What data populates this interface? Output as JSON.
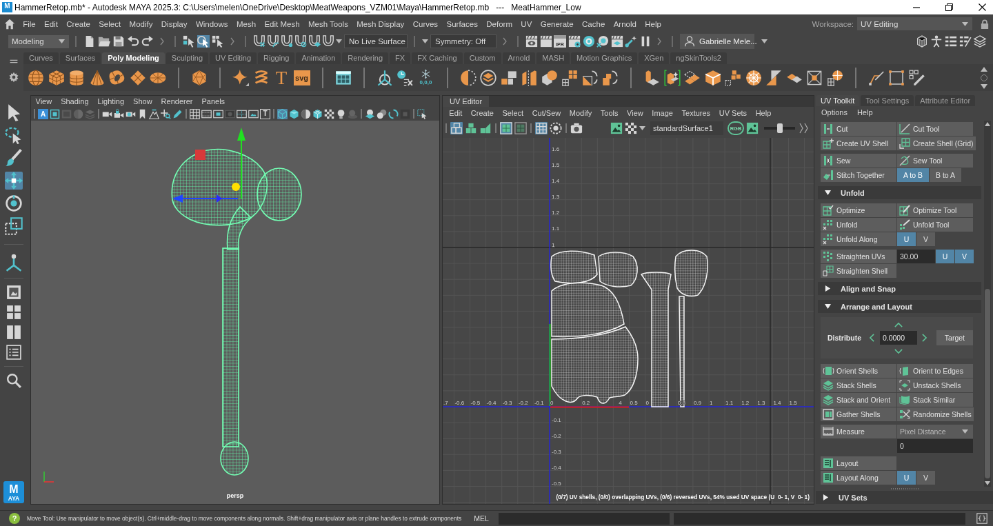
{
  "window": {
    "logo_letter": "M",
    "title": "HammerRetop.mb* - Autodesk MAYA 2025.3: C:\\Users\\melen\\OneDrive\\Desktop\\MeatWeapons_VZM01\\Maya\\HammerRetop.mb   ---   MeatHammer_Low"
  },
  "menu_bar": {
    "items": [
      "File",
      "Edit",
      "Create",
      "Select",
      "Modify",
      "Display",
      "Windows",
      "Mesh",
      "Edit Mesh",
      "Mesh Tools",
      "Mesh Display",
      "Curves",
      "Surfaces",
      "Deform",
      "UV",
      "Generate",
      "Cache",
      "Arnold",
      "Help"
    ],
    "workspace_label": "Workspace:",
    "workspace": "UV Editing"
  },
  "status_line": {
    "menu_set": "Modeling",
    "select_modes": [
      {
        "selected": false
      },
      {
        "selected": true
      },
      {
        "selected": false
      }
    ],
    "live_surface": "No Live Surface",
    "symmetry": "Symmetry: Off",
    "ipr_label": "IPR",
    "user": "Gabrielle Mele..."
  },
  "shelf": {
    "tabs": [
      {
        "label": "Curves",
        "selected": false
      },
      {
        "label": "Surfaces",
        "selected": false
      },
      {
        "label": "Poly Modeling",
        "selected": true
      },
      {
        "label": "Sculpting",
        "selected": false
      },
      {
        "label": "UV Editing",
        "selected": false
      },
      {
        "label": "Rigging",
        "selected": false
      },
      {
        "label": "Animation",
        "selected": false
      },
      {
        "label": "Rendering",
        "selected": false
      },
      {
        "label": "FX",
        "selected": false
      },
      {
        "label": "FX Caching",
        "selected": false
      },
      {
        "label": "Custom",
        "selected": false
      },
      {
        "label": "Arnold",
        "selected": false
      },
      {
        "label": "MASH",
        "selected": false
      },
      {
        "label": "Motion Graphics",
        "selected": false
      },
      {
        "label": "XGen",
        "selected": false
      },
      {
        "label": "ngSkinTools2",
        "selected": false
      }
    ],
    "text_tool_letter": "T",
    "svg_label": "svg",
    "freeze_caption": "0,0,0"
  },
  "toolbox": {
    "tools": [
      {
        "selected": false
      },
      {
        "selected": false
      },
      {
        "selected": false
      },
      {
        "selected": true
      },
      {
        "selected": false
      },
      {
        "selected": false
      }
    ],
    "logo": {
      "letter": "M",
      "caption": "AYA"
    }
  },
  "viewport": {
    "menu": [
      "View",
      "Shading",
      "Lighting",
      "Show",
      "Renderer",
      "Panels"
    ],
    "toolbar_letters": [
      "A",
      "T"
    ],
    "shading_modes": [
      {
        "selected": true
      },
      {
        "selected": false
      }
    ],
    "camera": "persp"
  },
  "uv_editor": {
    "tab": "UV Editor",
    "menu": [
      "Edit",
      "Create",
      "Select",
      "Cut/Sew",
      "Modify",
      "Tools",
      "View",
      "Image",
      "Textures",
      "UV Sets",
      "Help"
    ],
    "toolbar_groups": [
      [
        {
          "selected": true
        },
        {
          "selected": false
        },
        {
          "selected": false
        }
      ],
      [
        {
          "selected": true
        },
        {
          "selected": false
        }
      ],
      [
        {
          "selected": true
        },
        {
          "selected": false
        }
      ]
    ],
    "texture": "standardSurface1",
    "rgb_label": "RGB",
    "slider": {
      "level": 0.5
    },
    "v_ticks": [
      "1.6",
      "1.5",
      "1.4",
      "1.3",
      "1.2",
      "1.1",
      "1",
      "-0.1",
      "-0.2",
      "-0.3",
      "-0.4",
      "-0.5"
    ],
    "u_ticks": [
      ".7",
      "-0.6",
      "-0.5",
      "-0.4",
      "-0.3",
      "-0.2",
      "-0.1",
      "0",
      "0.2",
      "4",
      "0.5",
      "0",
      "0.8",
      "0.9",
      "1",
      "1.1",
      "1.2",
      "1.3",
      "1.4",
      "1.5"
    ],
    "stats": "(0/7) UV shells, (0/0) overlapping UVs, (0/6) reversed UVs, 54% used UV space (U  0- 1, V  0- 1)"
  },
  "uv_toolkit": {
    "tabs": [
      {
        "label": "UV Toolkit",
        "selected": true
      },
      {
        "label": "Tool Settings",
        "selected": false
      },
      {
        "label": "Attribute Editor",
        "selected": false
      }
    ],
    "menu": [
      "Options",
      "Help"
    ],
    "sections": [
      {
        "blocks": [
          [
            [
              {
                "kind": "button",
                "label": "Cut"
              },
              {
                "kind": "button",
                "label": "Cut Tool"
              }
            ],
            [
              {
                "kind": "button",
                "label": "Create UV Shell"
              },
              {
                "kind": "button",
                "label": "Create Shell (Grid)"
              }
            ]
          ],
          [
            [
              {
                "kind": "button",
                "label": "Sew"
              },
              {
                "kind": "button",
                "label": "Sew Tool"
              }
            ],
            [
              {
                "kind": "button",
                "label": "Stitch Together"
              },
              {
                "kind": "toggle",
                "label": "A to B",
                "selected": true
              },
              {
                "kind": "toggle",
                "label": "B to A",
                "selected": false
              }
            ]
          ]
        ]
      },
      {
        "title": "Unfold",
        "expanded": true,
        "blocks": [
          [
            [
              {
                "kind": "button",
                "label": "Optimize"
              },
              {
                "kind": "button",
                "label": "Optimize Tool"
              }
            ],
            [
              {
                "kind": "button",
                "label": "Unfold"
              },
              {
                "kind": "button",
                "label": "Unfold Tool"
              }
            ],
            [
              {
                "kind": "button",
                "label": "Unfold Along"
              },
              {
                "kind": "toggle",
                "label": "U",
                "selected": true
              },
              {
                "kind": "toggle",
                "label": "V",
                "selected": false
              }
            ]
          ],
          [
            [
              {
                "kind": "button",
                "label": "Straighten UVs"
              },
              {
                "kind": "field",
                "value": "30.00"
              },
              {
                "kind": "toggle",
                "label": "U",
                "selected": true
              },
              {
                "kind": "toggle",
                "label": "V",
                "selected": true
              }
            ],
            [
              {
                "kind": "button",
                "label": "Straighten Shell"
              }
            ]
          ]
        ]
      },
      {
        "title": "Align and Snap",
        "expanded": false
      },
      {
        "title": "Arrange and Layout",
        "expanded": true,
        "distribute": {
          "label": "Distribute",
          "value": "0.0000",
          "action": "Target"
        },
        "blocks": [
          [
            [
              {
                "kind": "button",
                "label": "Orient Shells"
              },
              {
                "kind": "button",
                "label": "Orient to Edges"
              }
            ],
            [
              {
                "kind": "button",
                "label": "Stack Shells"
              },
              {
                "kind": "button",
                "label": "Unstack Shells"
              }
            ],
            [
              {
                "kind": "button",
                "label": "Stack and Orient"
              },
              {
                "kind": "button",
                "label": "Stack Similar"
              }
            ],
            [
              {
                "kind": "button",
                "label": "Gather Shells"
              },
              {
                "kind": "button",
                "label": "Randomize Shells"
              }
            ]
          ],
          [
            [
              {
                "kind": "button",
                "label": "Measure"
              },
              {
                "kind": "dropdown",
                "value": "Pixel Distance"
              }
            ],
            [
              {
                "kind": "field",
                "value": "0"
              }
            ]
          ],
          [
            [
              {
                "kind": "button",
                "label": "Layout"
              }
            ],
            [
              {
                "kind": "button",
                "label": "Layout Along"
              },
              {
                "kind": "toggle",
                "label": "U",
                "selected": true
              },
              {
                "kind": "toggle",
                "label": "V",
                "selected": false
              }
            ]
          ]
        ]
      }
    ],
    "footer": {
      "title": "UV Sets",
      "expanded": false
    }
  },
  "help_line": {
    "help_mark": "?",
    "text": "Move Tool: Use manipulator to move object(s). Ctrl+middle-drag to move components along normals. Shift+drag manipulator axis or plane handles to extrude components",
    "command_language": "MEL"
  }
}
